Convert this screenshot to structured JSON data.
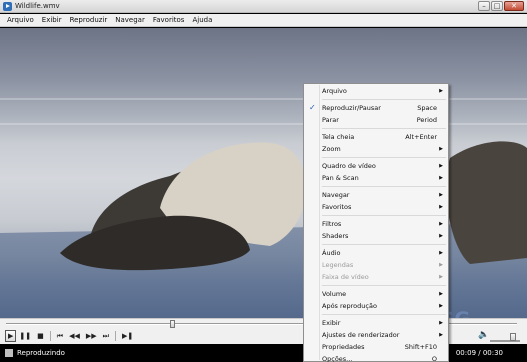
{
  "window": {
    "title": "Wildlife.wmv"
  },
  "menubar": {
    "items": [
      "Arquivo",
      "Exibir",
      "Reproduzir",
      "Navegar",
      "Favoritos",
      "Ajuda"
    ]
  },
  "status": {
    "text": "Reproduzindo",
    "time": "00:09 / 00:30"
  },
  "seek": {
    "position": 0.32
  },
  "volume": {
    "level": 0.75
  },
  "watermark": "ZIGG",
  "context_menu": {
    "groups": [
      [
        {
          "label": "Arquivo",
          "submenu": true
        }
      ],
      [
        {
          "label": "Reproduzir/Pausar",
          "shortcut": "Space",
          "checked": true
        },
        {
          "label": "Parar",
          "shortcut": "Period"
        }
      ],
      [
        {
          "label": "Tela cheia",
          "shortcut": "Alt+Enter"
        },
        {
          "label": "Zoom",
          "submenu": true
        }
      ],
      [
        {
          "label": "Quadro de vídeo",
          "submenu": true
        },
        {
          "label": "Pan & Scan",
          "submenu": true
        }
      ],
      [
        {
          "label": "Navegar",
          "submenu": true
        },
        {
          "label": "Favoritos",
          "submenu": true
        }
      ],
      [
        {
          "label": "Filtros",
          "submenu": true
        },
        {
          "label": "Shaders",
          "submenu": true
        }
      ],
      [
        {
          "label": "Áudio",
          "submenu": true
        },
        {
          "label": "Legendas",
          "submenu": true,
          "disabled": true
        },
        {
          "label": "Faixa de vídeo",
          "submenu": true,
          "disabled": true
        }
      ],
      [
        {
          "label": "Volume",
          "submenu": true
        },
        {
          "label": "Após reprodução",
          "submenu": true
        }
      ],
      [
        {
          "label": "Exibir",
          "submenu": true
        },
        {
          "label": "Ajustes de renderizador",
          "submenu": true
        },
        {
          "label": "Propriedades",
          "shortcut": "Shift+F10"
        },
        {
          "label": "Opções...",
          "shortcut": "O"
        }
      ]
    ]
  }
}
